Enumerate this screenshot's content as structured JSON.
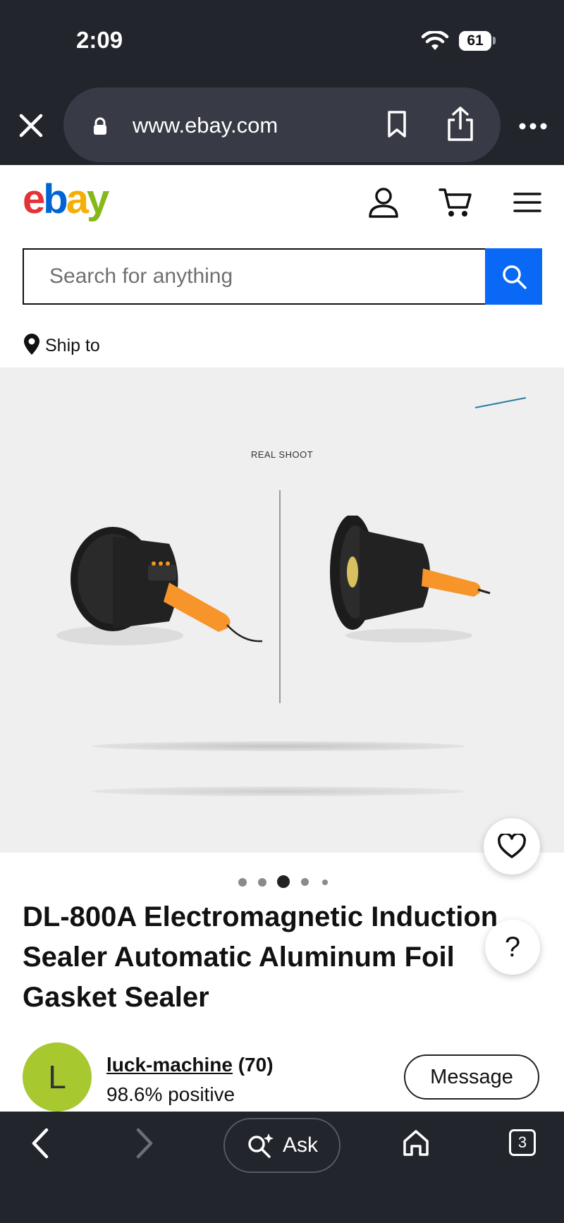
{
  "status_bar": {
    "time": "2:09",
    "battery": "61"
  },
  "browser": {
    "url": "www.ebay.com",
    "icons": [
      "close-icon",
      "lock-icon",
      "bookmark-icon",
      "share-icon",
      "more-icon"
    ]
  },
  "header": {
    "logo": {
      "e": "e",
      "b": "b",
      "a": "a",
      "y": "y"
    },
    "icons": [
      "account-icon",
      "cart-icon",
      "menu-icon"
    ]
  },
  "search": {
    "placeholder": "Search for anything",
    "value": ""
  },
  "ship": {
    "label": "Ship to"
  },
  "gallery": {
    "caption": "REAL SHOOT",
    "current_index": 3,
    "total": 5
  },
  "product": {
    "title": "DL-800A Electromagnetic Induction Sealer Automatic Aluminum Foil Gasket Sealer"
  },
  "seller": {
    "initial": "L",
    "name": "luck-machine",
    "feedback_count": "(70)",
    "positive": "98.6% positive",
    "message_label": "Message"
  },
  "help": {
    "label": "?"
  },
  "toolbar": {
    "ask_label": "Ask",
    "tab_count": "3"
  },
  "colors": {
    "chrome_bg": "#23252d",
    "search_blue": "#0968f6",
    "avatar_green": "#a8c830"
  }
}
